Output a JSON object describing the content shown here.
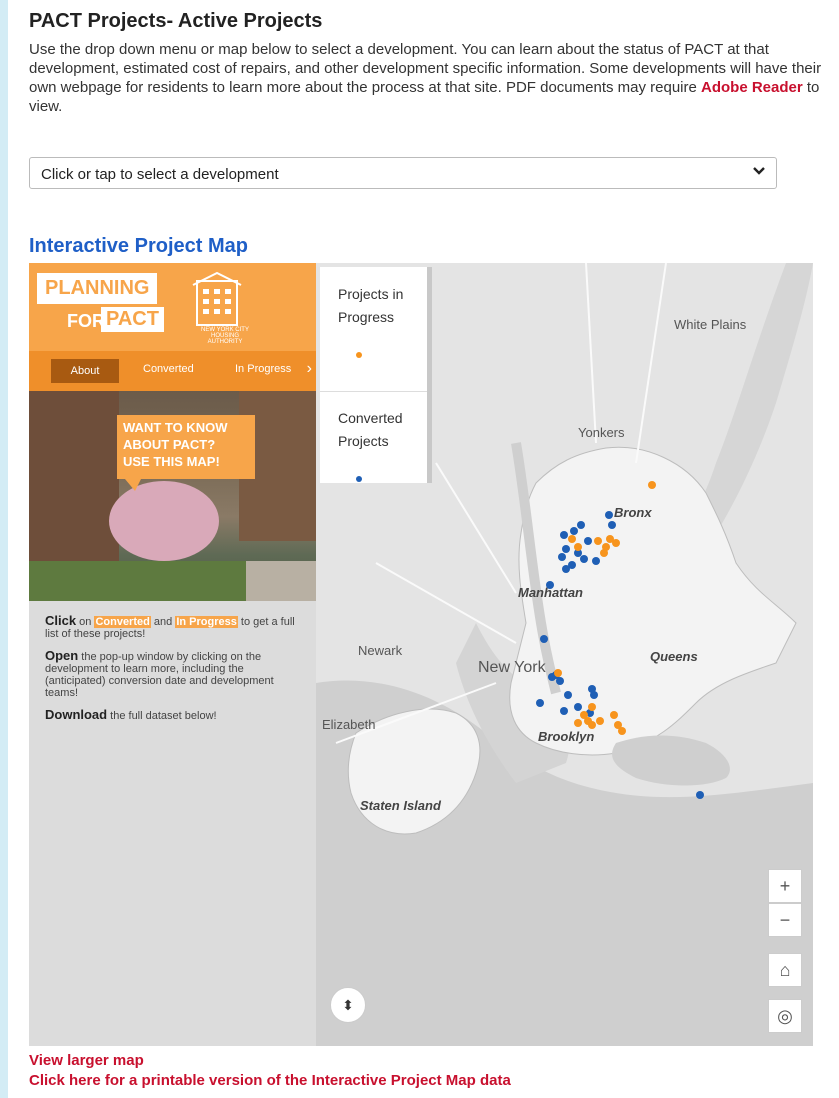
{
  "header": {
    "title": "PACT Projects- Active Projects",
    "intro_text": "Use the drop down menu or map below to select a development. You can learn about the status of PACT at that development, estimated cost of repairs, and other development specific information. Some developments will have their own webpage for residents to learn more about the process at that site. PDF documents may require ",
    "adobe_link": "Adobe Reader",
    "intro_tail": " to view."
  },
  "dropdown": {
    "selected": "Click or tap to select a development",
    "icon": "chevron-down-icon"
  },
  "map_section": {
    "heading": "Interactive Project Map"
  },
  "side_panel": {
    "logo_line1": "PLANNING",
    "logo_for": "FOR",
    "logo_pact": "PACT",
    "authority": "NEW YORK CITY HOUSING AUTHORITY",
    "nav": {
      "about": "About",
      "converted": "Converted",
      "in_progress": "In Progress",
      "arrow": "›"
    },
    "bubble": [
      "WANT TO KNOW",
      "ABOUT PACT?",
      "USE THIS MAP!"
    ],
    "info": {
      "click_word": "Click",
      "click_on": " on ",
      "converted_hl": "Converted",
      "and": " and ",
      "in_progress_hl": "In Progress",
      "click_tail": " to get a full list of these projects!",
      "open_word": "Open",
      "open_tail": " the pop-up window by clicking on the development to learn more, including the (anticipated) conversion date and development teams!",
      "download_word": "Download",
      "download_tail": " the full dataset below!"
    }
  },
  "legend": {
    "in_progress": [
      "Projects in",
      "Progress"
    ],
    "converted": [
      "Converted",
      "Projects"
    ],
    "colors": {
      "in_progress": "#f7941d",
      "converted": "#1f5fb5"
    }
  },
  "places": {
    "white_plains": "White Plains",
    "yonkers": "Yonkers",
    "bronx": "Bronx",
    "manhattan": "Manhattan",
    "newark": "Newark",
    "new_york": "New York",
    "queens": "Queens",
    "elizabeth": "Elizabeth",
    "brooklyn": "Brooklyn",
    "staten_island": "Staten Island"
  },
  "map_controls": {
    "zoom_in": "+",
    "zoom_out": "−",
    "home": "⌂",
    "locate": "◎",
    "compass": "⬍"
  },
  "links": {
    "larger_map": "View larger map",
    "printable": "Click here for a printable version of the Interactive Project Map data"
  }
}
